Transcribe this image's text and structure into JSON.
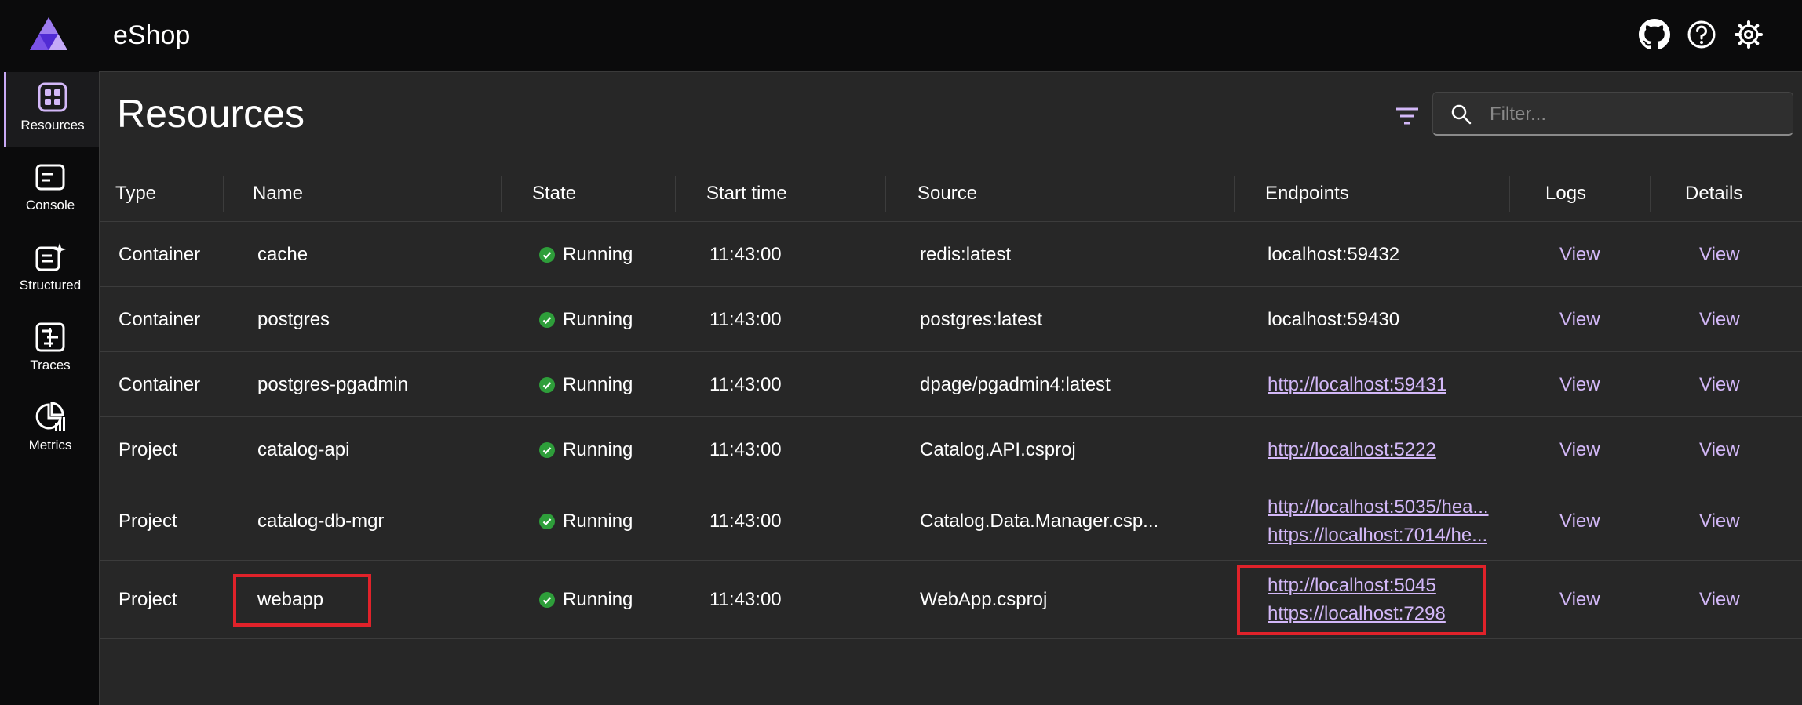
{
  "app": {
    "title": "eShop"
  },
  "nav": [
    {
      "label": "Resources",
      "icon": "resources-icon",
      "active": true
    },
    {
      "label": "Console",
      "icon": "console-icon"
    },
    {
      "label": "Structured",
      "icon": "structured-icon"
    },
    {
      "label": "Traces",
      "icon": "traces-icon"
    },
    {
      "label": "Metrics",
      "icon": "metrics-icon"
    }
  ],
  "header_icons": [
    "github-icon",
    "help-icon",
    "settings-icon"
  ],
  "page": {
    "title": "Resources"
  },
  "search": {
    "placeholder": "Filter..."
  },
  "table": {
    "columns": [
      "Type",
      "Name",
      "State",
      "Start time",
      "Source",
      "Endpoints",
      "Logs",
      "Details"
    ],
    "rows": [
      {
        "type": "Container",
        "name": "cache",
        "state": "Running",
        "start": "11:43:00",
        "source": "redis:latest",
        "endpoints": [
          {
            "text": "localhost:59432",
            "link": false
          }
        ],
        "logs": "View",
        "details": "View"
      },
      {
        "type": "Container",
        "name": "postgres",
        "state": "Running",
        "start": "11:43:00",
        "source": "postgres:latest",
        "endpoints": [
          {
            "text": "localhost:59430",
            "link": false
          }
        ],
        "logs": "View",
        "details": "View"
      },
      {
        "type": "Container",
        "name": "postgres-pgadmin",
        "state": "Running",
        "start": "11:43:00",
        "source": "dpage/pgadmin4:latest",
        "endpoints": [
          {
            "text": "http://localhost:59431",
            "link": true
          }
        ],
        "logs": "View",
        "details": "View"
      },
      {
        "type": "Project",
        "name": "catalog-api",
        "state": "Running",
        "start": "11:43:00",
        "source": "Catalog.API.csproj",
        "endpoints": [
          {
            "text": "http://localhost:5222",
            "link": true
          }
        ],
        "logs": "View",
        "details": "View"
      },
      {
        "type": "Project",
        "name": "catalog-db-mgr",
        "state": "Running",
        "start": "11:43:00",
        "source": "Catalog.Data.Manager.csp...",
        "endpoints": [
          {
            "text": "http://localhost:5035/hea...",
            "link": true
          },
          {
            "text": "https://localhost:7014/he...",
            "link": true
          }
        ],
        "logs": "View",
        "details": "View"
      },
      {
        "type": "Project",
        "name": "webapp",
        "state": "Running",
        "start": "11:43:00",
        "source": "WebApp.csproj",
        "endpoints": [
          {
            "text": "http://localhost:5045",
            "link": true
          },
          {
            "text": "https://localhost:7298",
            "link": true
          }
        ],
        "logs": "View",
        "details": "View"
      }
    ]
  },
  "colors": {
    "accent": "#d3b8f8",
    "running": "#2e9e3a",
    "highlight": "#e0222a",
    "background": "#272727"
  }
}
